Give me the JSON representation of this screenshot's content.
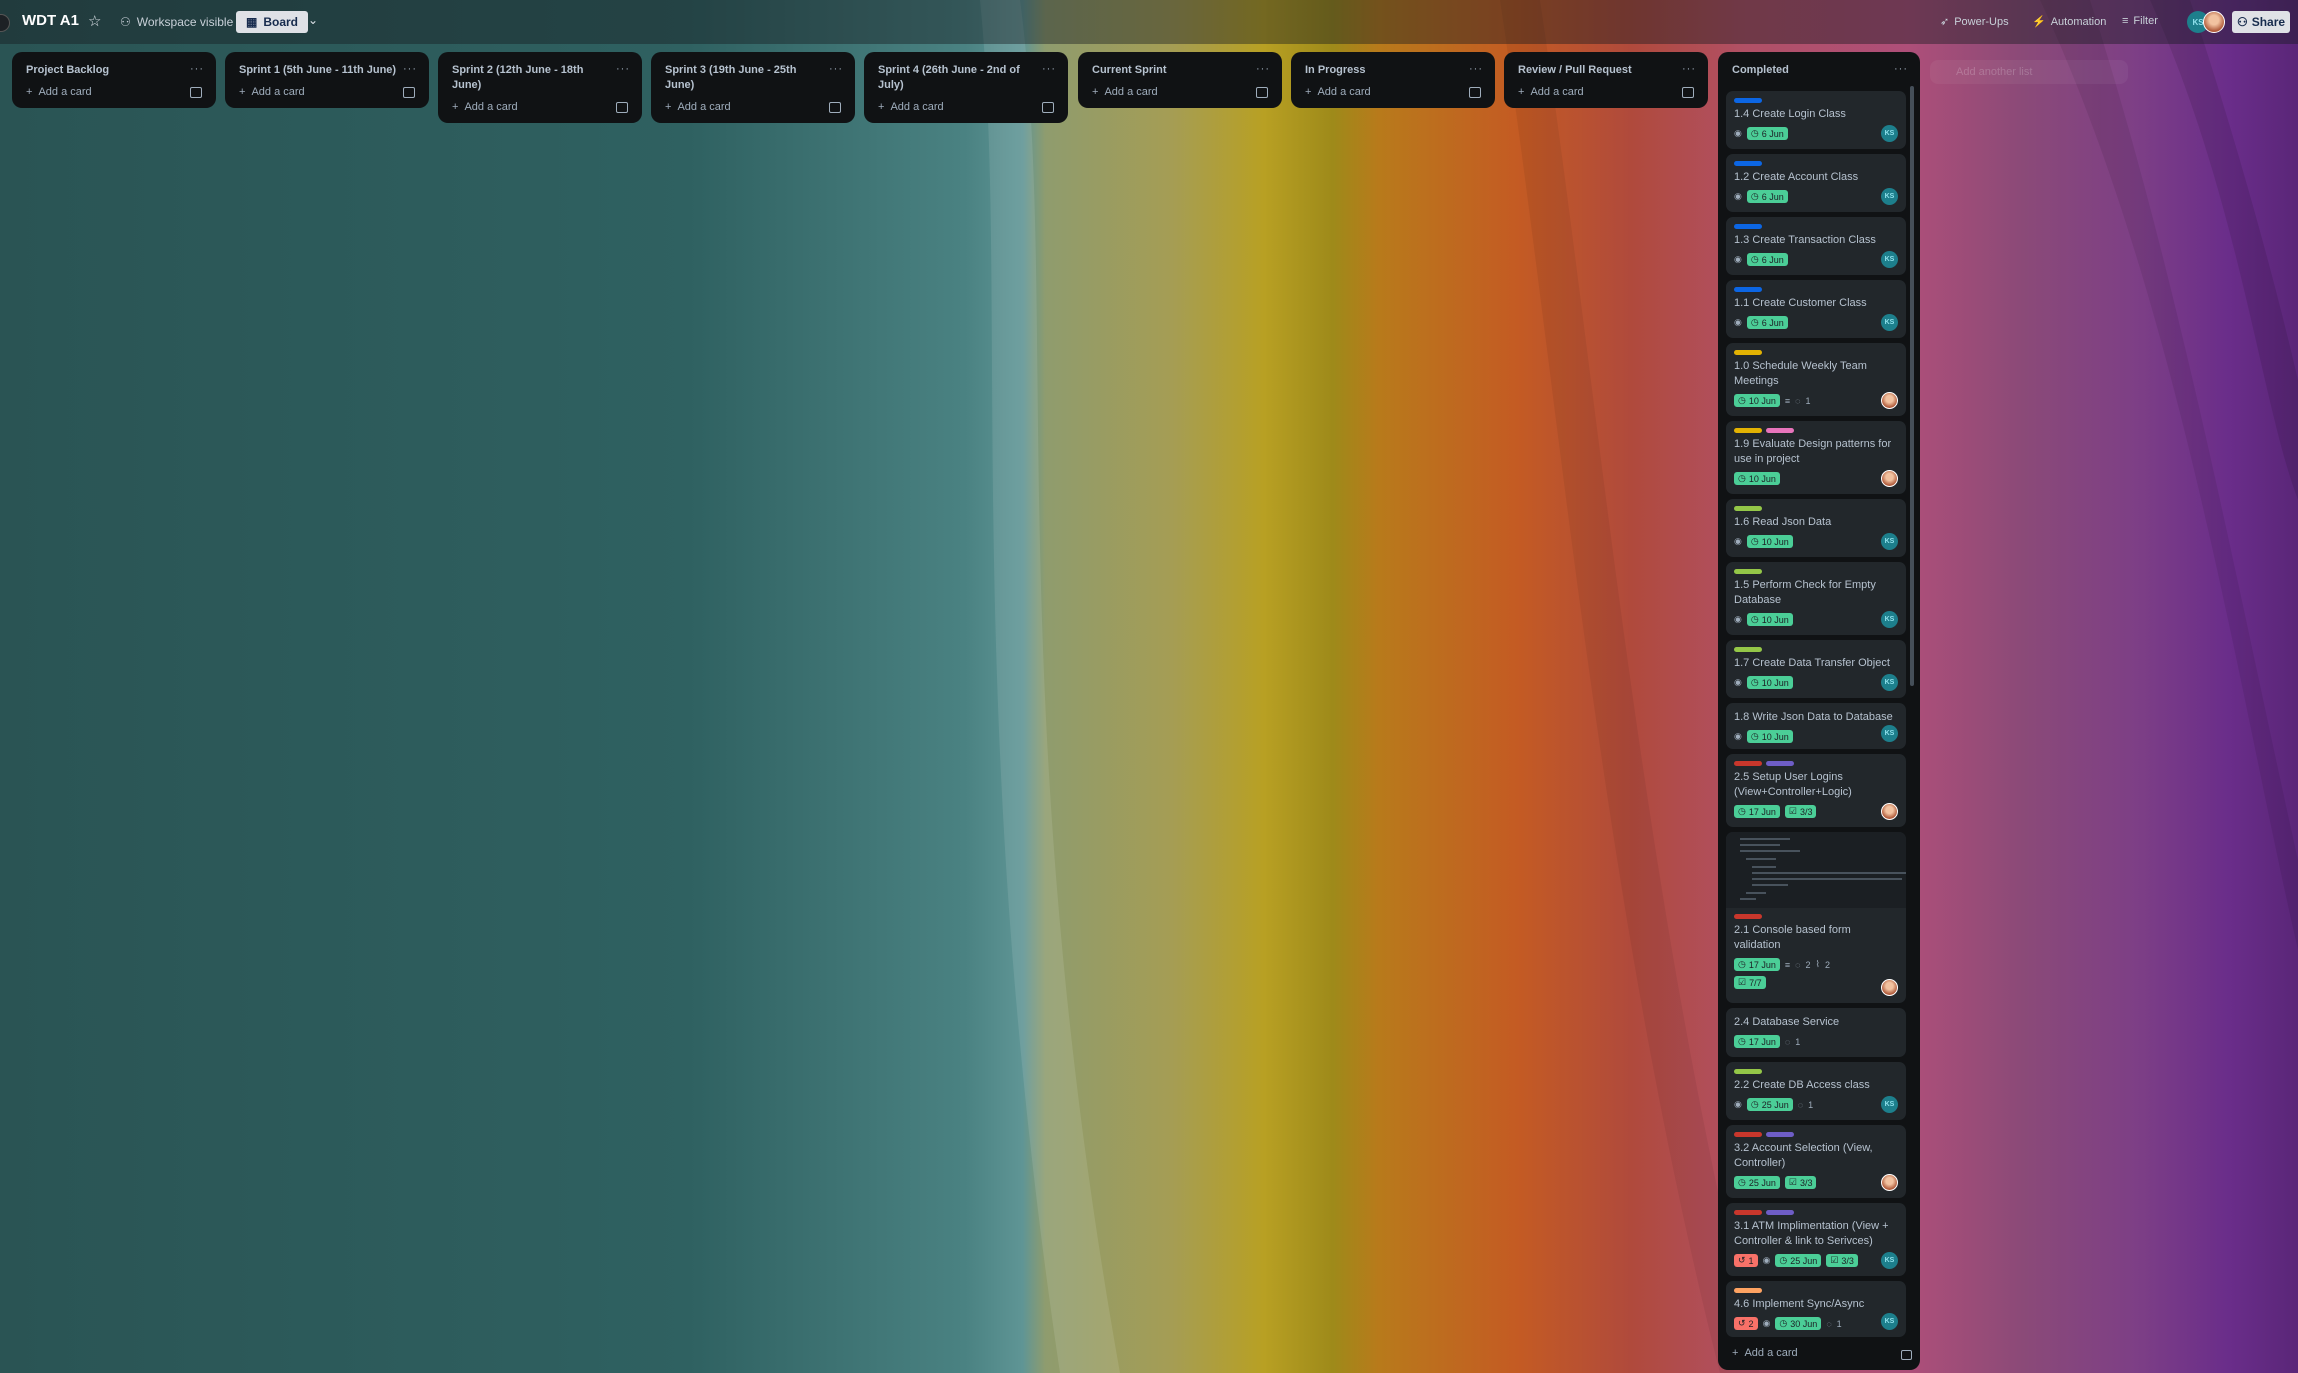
{
  "topbar": {
    "board_title": "WDT A1",
    "visibility": "Workspace visible",
    "view": "Board",
    "power_ups": "Power-Ups",
    "automation": "Automation",
    "filter": "Filter",
    "share": "Share",
    "member_initials": "KS"
  },
  "lists": [
    {
      "title": "Project Backlog",
      "add": "Add a card"
    },
    {
      "title": "Sprint 1 (5th June - 11th June)",
      "add": "Add a card"
    },
    {
      "title": "Sprint 2 (12th June - 18th June)",
      "add": "Add a card"
    },
    {
      "title": "Sprint 3 (19th June - 25th June)",
      "add": "Add a card"
    },
    {
      "title": "Sprint 4 (26th June - 2nd of July)",
      "add": "Add a card"
    },
    {
      "title": "Current Sprint",
      "add": "Add a card"
    },
    {
      "title": "In Progress",
      "add": "Add a card"
    },
    {
      "title": "Review / Pull Request",
      "add": "Add a card"
    }
  ],
  "completed": {
    "title": "Completed",
    "add": "Add a card",
    "cards": [
      {
        "title": "1.4 Create Login Class",
        "due": "6 Jun",
        "member": "KS"
      },
      {
        "title": "1.2 Create Account Class",
        "due": "6 Jun",
        "member": "KS"
      },
      {
        "title": "1.3 Create Transaction Class",
        "due": "6 Jun",
        "member": "KS"
      },
      {
        "title": "1.1 Create Customer Class",
        "due": "6 Jun",
        "member": "KS"
      },
      {
        "title": "1.0 Schedule Weekly Team Meetings",
        "due": "10 Jun",
        "comments": "1"
      },
      {
        "title": "1.9 Evaluate Design patterns for use in project",
        "due": "10 Jun"
      },
      {
        "title": "1.6 Read Json Data",
        "due": "10 Jun",
        "member": "KS"
      },
      {
        "title": "1.5 Perform Check for Empty Database",
        "due": "10 Jun",
        "member": "KS"
      },
      {
        "title": "1.7 Create Data Transfer Object",
        "due": "10 Jun",
        "member": "KS"
      },
      {
        "title": "1.8 Write Json Data to Database",
        "due": "10 Jun",
        "member": "KS"
      },
      {
        "title": "2.5 Setup User Logins (View+Controller+Logic)",
        "due": "17 Jun",
        "checklist": "3/3"
      },
      {
        "title": "2.1 Console based form validation",
        "due": "17 Jun",
        "comments": "2",
        "attachments": "2",
        "checklist": "7/7"
      },
      {
        "title": "2.4 Database Service",
        "due": "17 Jun",
        "comments": "1"
      },
      {
        "title": "2.2 Create DB Access class",
        "due": "25 Jun",
        "comments": "1",
        "member": "KS"
      },
      {
        "title": "3.2 Account Selection (View, Controller)",
        "due": "25 Jun",
        "checklist": "3/3"
      },
      {
        "title": "3.1 ATM Implimentation (View + Controller & link to Serivces)",
        "alert": "1",
        "due": "25 Jun",
        "checklist": "3/3",
        "member": "KS"
      },
      {
        "title": "4.6 Implement Sync/Async",
        "alert": "2",
        "due": "30 Jun",
        "comments": "1",
        "member": "KS"
      }
    ]
  },
  "add_another_list": "Add another list",
  "colors": {
    "label_blue": "#0c66e4",
    "label_yellow": "#e2b203",
    "label_pink": "#e774bb",
    "label_lime": "#94c748",
    "label_red": "#c9372c",
    "label_purple": "#6e5dc6",
    "label_orange": "#fea362",
    "due_complete": "#4bce97"
  }
}
